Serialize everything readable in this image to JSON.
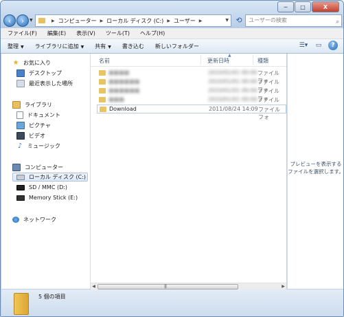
{
  "window": {
    "controls": {
      "minimize": "─",
      "maximize": "□",
      "close": "X"
    }
  },
  "nav": {
    "back_icon": "arrow-left",
    "forward_icon": "arrow-right",
    "breadcrumbs": [
      "コンピューター",
      "ローカル ディスク (C:)",
      "ユーザー"
    ],
    "search_placeholder": "ユーザーの検索"
  },
  "menu": [
    "ファイル(F)",
    "編集(E)",
    "表示(V)",
    "ツール(T)",
    "ヘルプ(H)"
  ],
  "toolbar": {
    "organize": "整理",
    "include_library": "ライブラリに追加",
    "share": "共有",
    "burn": "書き込む",
    "new_folder": "新しいフォルダー"
  },
  "sidebar": {
    "favorites": {
      "label": "お気に入り",
      "items": [
        "デスクトップ",
        "最近表示した場所"
      ]
    },
    "libraries": {
      "label": "ライブラリ",
      "items": [
        "ドキュメント",
        "ピクチャ",
        "ビデオ",
        "ミュージック"
      ]
    },
    "computer": {
      "label": "コンピューター",
      "items": [
        "ローカル ディスク (C:)",
        "SD / MMC (D:)",
        "Memory Stick (E:)"
      ]
    },
    "network": {
      "label": "ネットワーク"
    }
  },
  "columns": {
    "name": "名前",
    "date": "更新日時",
    "type": "種類"
  },
  "files": [
    {
      "name": "■■■■",
      "date": "2010/01/01 00:00",
      "type": "ファイル フォ",
      "blurred": true
    },
    {
      "name": "■■■■■■",
      "date": "2010/01/01 00:00",
      "type": "ファイル フォ",
      "blurred": true
    },
    {
      "name": "■■■■■■",
      "date": "2010/01/01 00:00",
      "type": "ファイル フォ",
      "blurred": true
    },
    {
      "name": "■■■",
      "date": "2010/01/01 00:00",
      "type": "ファイル フォ",
      "blurred": true
    },
    {
      "name": "Download",
      "date": "2011/08/24 14:09",
      "type": "ファイル フォ",
      "blurred": false
    }
  ],
  "preview": {
    "message": "プレビューを表示するファイルを選択します。"
  },
  "status": {
    "count": "5 個の項目"
  },
  "colors": {
    "accent": "#b9d1ea",
    "folder": "#e9c463"
  }
}
